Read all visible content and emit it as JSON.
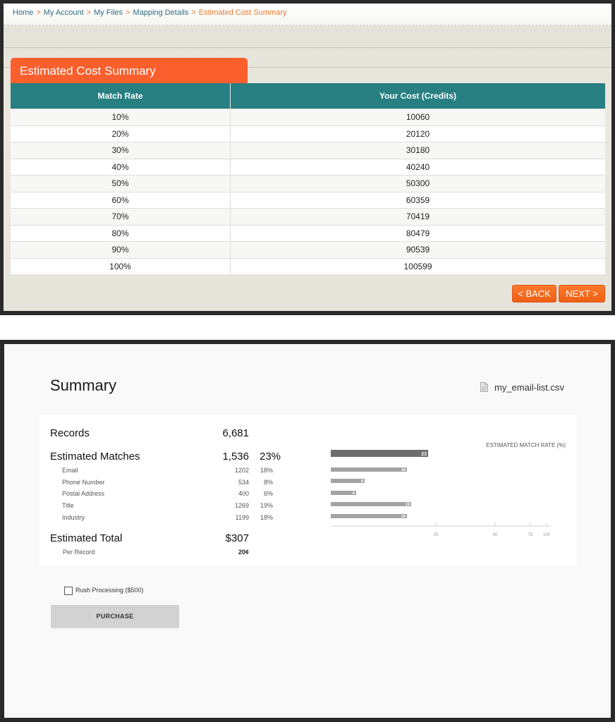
{
  "breadcrumb": {
    "items": [
      "Home",
      "My Account",
      "My Files",
      "Mapping Details",
      "Estimated Cost Summary"
    ],
    "separator": ">"
  },
  "cost_summary": {
    "title": "Estimated Cost Summary",
    "columns": [
      "Match Rate",
      "Your Cost (Credits)"
    ],
    "rows": [
      [
        "10%",
        "10060"
      ],
      [
        "20%",
        "20120"
      ],
      [
        "30%",
        "30180"
      ],
      [
        "40%",
        "40240"
      ],
      [
        "50%",
        "50300"
      ],
      [
        "60%",
        "60359"
      ],
      [
        "70%",
        "70419"
      ],
      [
        "80%",
        "80479"
      ],
      [
        "90%",
        "90539"
      ],
      [
        "100%",
        "100599"
      ]
    ],
    "back_label": "< BACK",
    "next_label": "NEXT >"
  },
  "summary": {
    "title": "Summary",
    "file_name": "my_email-list.csv",
    "file_icon": "document-icon",
    "records_label": "Records",
    "records_value": "6,681",
    "matches_label": "Estimated Matches",
    "matches_value": "1,536",
    "matches_pct": "23%",
    "fields": [
      {
        "label": "Email",
        "count": "1202",
        "pct": "18%"
      },
      {
        "label": "Phone Number",
        "count": "534",
        "pct": "8%"
      },
      {
        "label": "Postal Address",
        "count": "400",
        "pct": "6%"
      },
      {
        "label": "Title",
        "count": "1269",
        "pct": "19%"
      },
      {
        "label": "Industry",
        "count": "1199",
        "pct": "18%"
      }
    ],
    "total_label": "Estimated Total",
    "total_value": "$307",
    "per_record_label": "Per Record",
    "per_record_value": "20¢",
    "rush_label": "Rush Processing ($500)",
    "rush_checked": false,
    "purchase_label": "PURCHASE"
  },
  "chart_data": {
    "type": "bar",
    "orientation": "horizontal",
    "title": "ESTIMATED MATCH RATE (%)",
    "values": [
      23,
      18,
      8,
      6,
      19,
      18
    ],
    "xticks": [
      "25",
      "50",
      "75",
      "100"
    ],
    "xlim": [
      0,
      100
    ],
    "colors": {
      "total": "#6d6d6d",
      "field": "#a3a3a3"
    }
  },
  "colors": {
    "teal_header": "#287f82",
    "orange_accent": "#fb5f2d",
    "link": "#2f6f80"
  }
}
